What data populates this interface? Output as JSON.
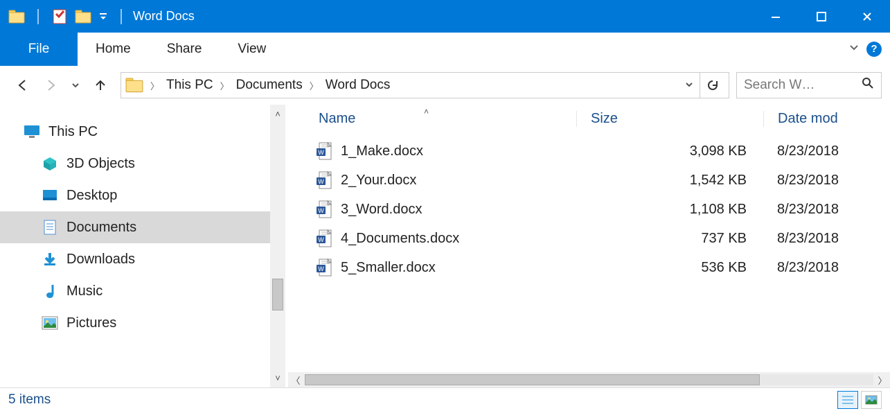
{
  "window": {
    "title": "Word Docs"
  },
  "ribbon": {
    "file": "File",
    "tabs": [
      "Home",
      "Share",
      "View"
    ]
  },
  "breadcrumb": {
    "items": [
      "This PC",
      "Documents",
      "Word Docs"
    ]
  },
  "search": {
    "placeholder": "Search W…"
  },
  "tree": {
    "root": "This PC",
    "children": [
      {
        "label": "3D Objects"
      },
      {
        "label": "Desktop"
      },
      {
        "label": "Documents",
        "selected": true
      },
      {
        "label": "Downloads"
      },
      {
        "label": "Music"
      },
      {
        "label": "Pictures"
      }
    ]
  },
  "columns": {
    "name": "Name",
    "size": "Size",
    "date": "Date mod"
  },
  "files": [
    {
      "name": "1_Make.docx",
      "size": "3,098 KB",
      "date": "8/23/2018"
    },
    {
      "name": "2_Your.docx",
      "size": "1,542 KB",
      "date": "8/23/2018"
    },
    {
      "name": "3_Word.docx",
      "size": "1,108 KB",
      "date": "8/23/2018"
    },
    {
      "name": "4_Documents.docx",
      "size": "737 KB",
      "date": "8/23/2018"
    },
    {
      "name": "5_Smaller.docx",
      "size": "536 KB",
      "date": "8/23/2018"
    }
  ],
  "status": {
    "text": "5 items"
  }
}
